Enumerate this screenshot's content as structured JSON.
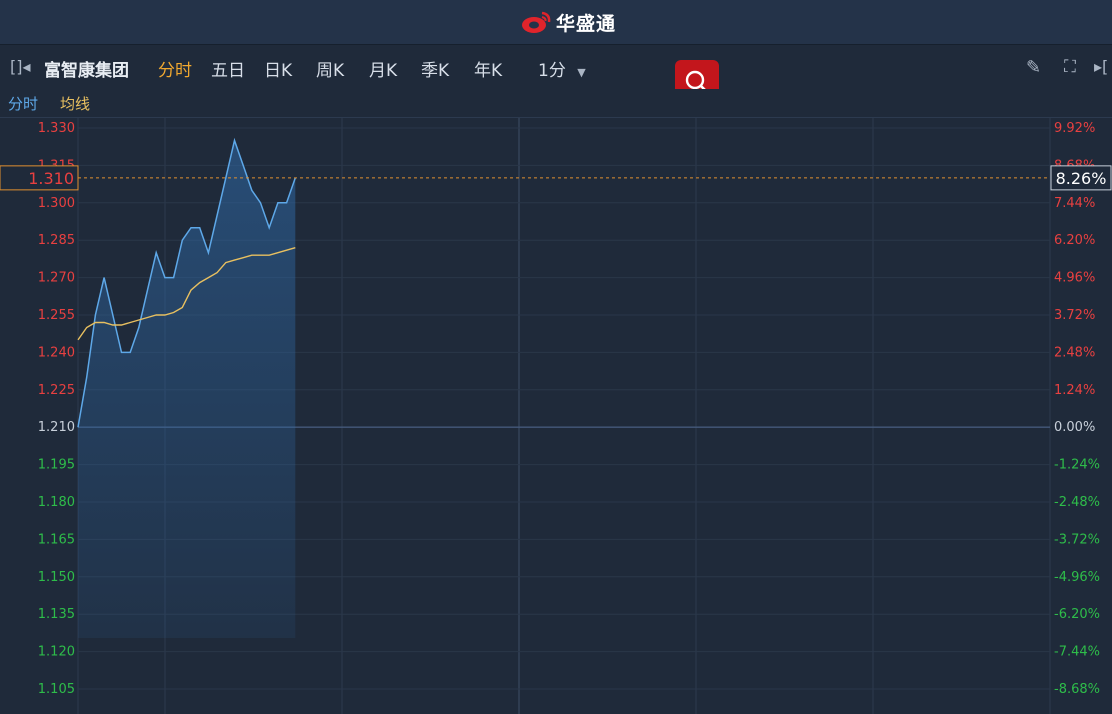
{
  "header": {
    "brand": "华盛通"
  },
  "toolbar": {
    "stock_name": "富智康集团",
    "tabs": [
      {
        "label": "分时",
        "active": true
      },
      {
        "label": "五日",
        "active": false
      },
      {
        "label": "日K",
        "active": false
      },
      {
        "label": "周K",
        "active": false
      },
      {
        "label": "月K",
        "active": false
      },
      {
        "label": "季K",
        "active": false
      },
      {
        "label": "年K",
        "active": false
      }
    ],
    "interval": "1分"
  },
  "legend": {
    "price": "分时",
    "avg": "均线"
  },
  "colors": {
    "up": "#e84040",
    "down": "#2ebd4a",
    "neutral": "#c8d0da",
    "price_line": "#5ea8e8",
    "avg_line": "#e8c060",
    "cursor": "#e09030"
  },
  "chart_data": {
    "type": "line",
    "prev_close": 1.21,
    "ylim": [
      1.09,
      1.33
    ],
    "y_ticks_left": [
      "1.330",
      "1.315",
      "1.300",
      "1.285",
      "1.270",
      "1.255",
      "1.240",
      "1.225",
      "1.210",
      "1.195",
      "1.180",
      "1.165",
      "1.150",
      "1.135",
      "1.120",
      "1.105"
    ],
    "y_ticks_right": [
      "9.92%",
      "8.68%",
      "7.44%",
      "6.20%",
      "4.96%",
      "3.72%",
      "2.48%",
      "1.24%",
      "0.00%",
      "-1.24%",
      "-2.48%",
      "-3.72%",
      "-4.96%",
      "-6.20%",
      "-7.44%",
      "-8.68%"
    ],
    "cursor": {
      "price": "1.310",
      "pct": "8.26%"
    },
    "series": [
      {
        "values": [
          1.21,
          1.23,
          1.255,
          1.27,
          1.255,
          1.24,
          1.24,
          1.25,
          1.265,
          1.28,
          1.27,
          1.27,
          1.285,
          1.29,
          1.29,
          1.28,
          1.295,
          1.31,
          1.325,
          1.315,
          1.305,
          1.3,
          1.29,
          1.3,
          1.3,
          1.31
        ]
      },
      {
        "values": [
          1.245,
          1.25,
          1.252,
          1.252,
          1.251,
          1.251,
          1.252,
          1.253,
          1.254,
          1.255,
          1.255,
          1.256,
          1.258,
          1.265,
          1.268,
          1.27,
          1.272,
          1.276,
          1.277,
          1.278,
          1.279,
          1.279,
          1.279,
          1.28,
          1.281,
          1.282
        ]
      }
    ]
  }
}
